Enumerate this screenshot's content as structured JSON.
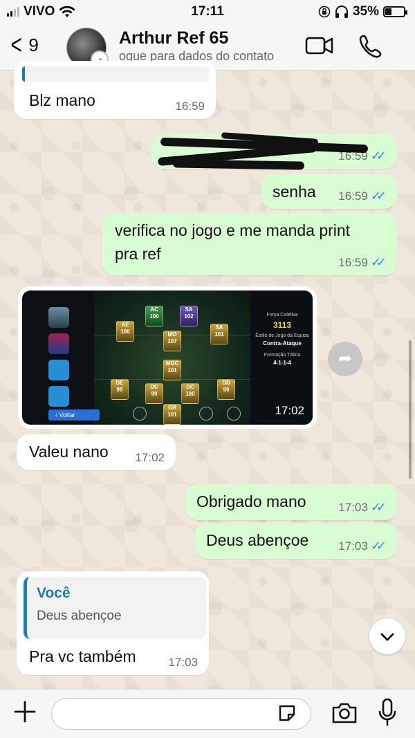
{
  "status_bar": {
    "carrier": "VIVO",
    "time": "17:11",
    "battery": "35%",
    "battery_level": 0.35
  },
  "header": {
    "back_count": "9",
    "contact_name": "Arthur Ref 65",
    "contact_subtitle": "oque para dados do contato"
  },
  "messages": {
    "m1": {
      "text": "Blz mano",
      "time": "16:59"
    },
    "m2": {
      "time": "16:59"
    },
    "m3": {
      "text": "senha",
      "time": "16:59"
    },
    "m4": {
      "line1": "verifica no jogo e me manda print",
      "line2": "pra ref",
      "time": "16:59"
    },
    "m5": {
      "time": "17:02",
      "game": {
        "back_label": "Voltar",
        "panel": {
          "strength_label": "Força Coletiva",
          "strength_value": "3113",
          "style_label": "Estilo de Jogo da Equipa",
          "style_value": "Contra-Ataque",
          "formation_label": "Formação Tática",
          "formation_value": "4-1-1-4"
        },
        "cards": [
          {
            "pos": "AC",
            "rating": "100"
          },
          {
            "pos": "SA",
            "rating": "102"
          },
          {
            "pos": "AE",
            "rating": "100"
          },
          {
            "pos": "MO",
            "rating": "107"
          },
          {
            "pos": "SA",
            "rating": "101"
          },
          {
            "pos": "MDC",
            "rating": "101"
          },
          {
            "pos": "DE",
            "rating": "99"
          },
          {
            "pos": "DC",
            "rating": "99"
          },
          {
            "pos": "DC",
            "rating": "100"
          },
          {
            "pos": "DD",
            "rating": "99"
          },
          {
            "pos": "GR",
            "rating": "101"
          }
        ]
      }
    },
    "m6": {
      "text": "Valeu nano",
      "time": "17:02"
    },
    "m7": {
      "text": "Obrigado mano",
      "time": "17:03"
    },
    "m8": {
      "text": "Deus abençoe",
      "time": "17:03"
    },
    "m9": {
      "reply_author": "Você",
      "reply_text": "Deus abençoe",
      "text": "Pra vc também",
      "time": "17:03"
    }
  },
  "input": {
    "placeholder": ""
  },
  "icons": [
    "back-icon",
    "video-call-icon",
    "phone-icon",
    "forward-icon",
    "scroll-down-icon",
    "plus-icon",
    "sticker-icon",
    "camera-icon",
    "mic-icon",
    "wifi-icon",
    "headphones-icon",
    "lock-rotation-icon"
  ],
  "colors": {
    "incoming": "#ffffff",
    "outgoing": "#d9fdd3",
    "read_ticks": "#3e8ad8",
    "reply_accent": "#1c7cb8"
  }
}
